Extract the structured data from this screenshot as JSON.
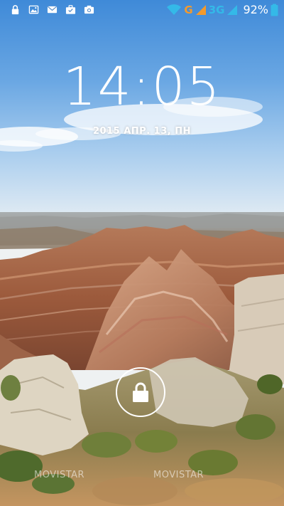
{
  "status_bar": {
    "left_icons": [
      "lock-icon",
      "image-icon",
      "mail-icon",
      "briefcase-icon",
      "camera-icon"
    ],
    "right": {
      "wifi_icon": "wifi-icon",
      "network_1_label": "G",
      "network_1_color": "#f39a2c",
      "network_2_label": "3G",
      "network_2_color": "#34b9e8",
      "battery_percent": "92%",
      "battery_color": "#34b9e8"
    }
  },
  "lockscreen": {
    "time": "14:05",
    "date": "2015 АПР. 13, ПН",
    "unlock_icon": "padlock-icon"
  },
  "carrier": {
    "left": "MOVISTAR",
    "right": "MOVISTAR"
  }
}
